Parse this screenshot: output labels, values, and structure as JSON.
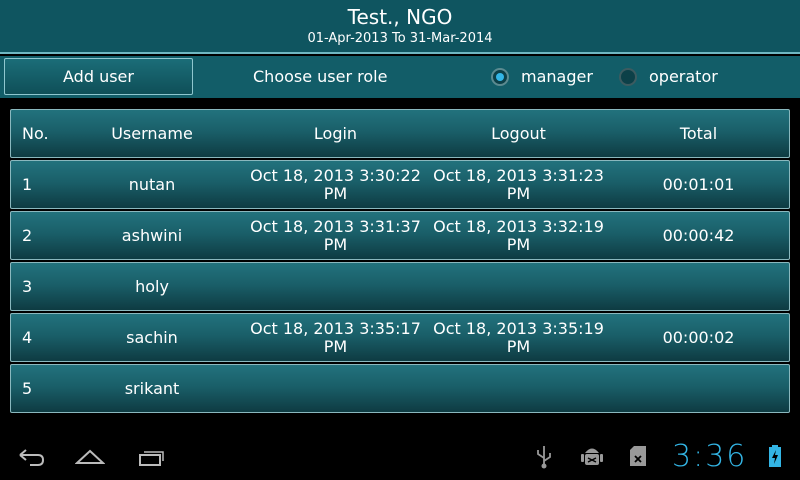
{
  "header": {
    "title": "Test., NGO",
    "subtitle": "01-Apr-2013 To 31-Mar-2014"
  },
  "toolbar": {
    "add_user_label": "Add user",
    "role_label": "Choose user role",
    "roles": [
      {
        "label": "manager",
        "checked": true
      },
      {
        "label": "operator",
        "checked": false
      }
    ]
  },
  "table": {
    "headers": [
      "No.",
      "Username",
      "Login",
      "Logout",
      "Total"
    ],
    "rows": [
      {
        "no": "1",
        "username": "nutan",
        "login": "Oct 18, 2013 3:30:22 PM",
        "logout": "Oct 18, 2013 3:31:23 PM",
        "total": "00:01:01"
      },
      {
        "no": "2",
        "username": "ashwini",
        "login": "Oct 18, 2013 3:31:37 PM",
        "logout": "Oct 18, 2013 3:32:19 PM",
        "total": "00:00:42"
      },
      {
        "no": "3",
        "username": "holy",
        "login": "",
        "logout": "",
        "total": ""
      },
      {
        "no": "4",
        "username": "sachin",
        "login": "Oct 18, 2013 3:35:17 PM",
        "logout": "Oct 18, 2013 3:35:19 PM",
        "total": "00:00:02"
      },
      {
        "no": "5",
        "username": "srikant",
        "login": "",
        "logout": "",
        "total": ""
      }
    ]
  },
  "navbar": {
    "icons": [
      "back-icon",
      "home-icon",
      "recent-apps-icon",
      "usb-icon",
      "android-debug-icon",
      "sd-card-icon",
      "battery-charging-icon"
    ],
    "clock": "3:36",
    "accent": "#33b5e5"
  }
}
